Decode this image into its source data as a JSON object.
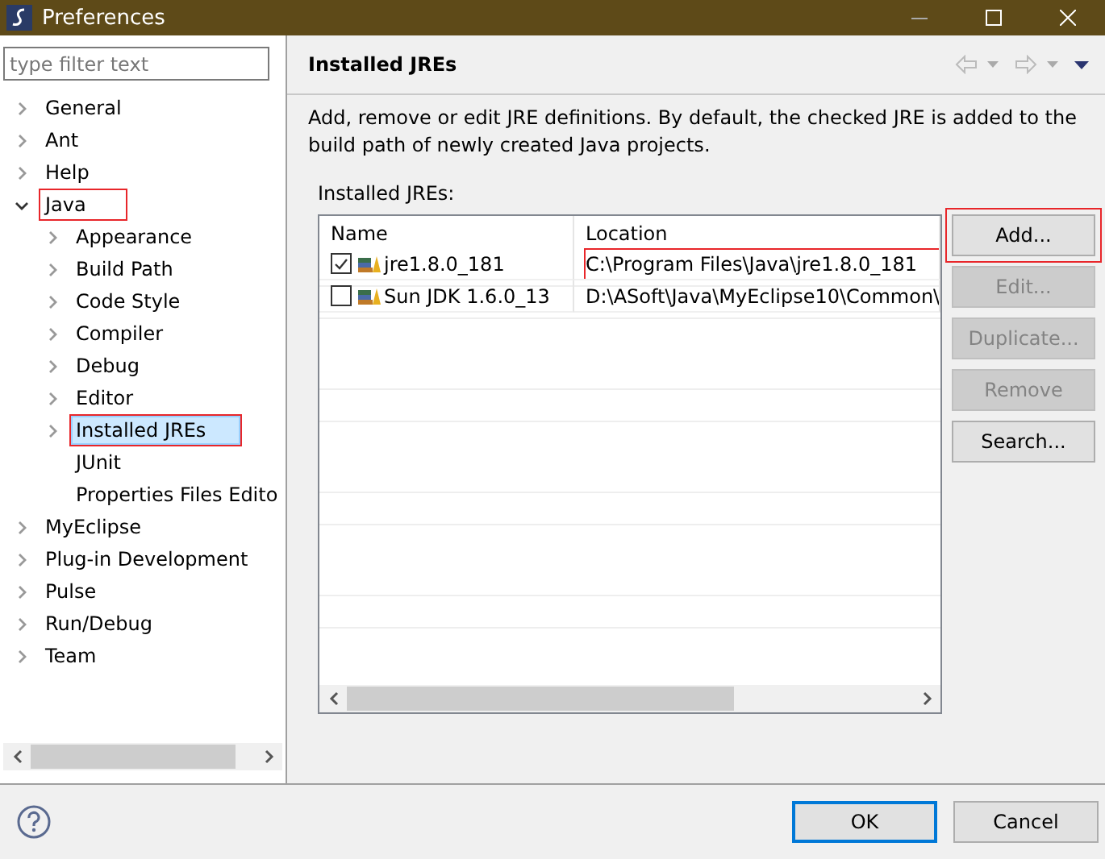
{
  "window": {
    "title": "Preferences"
  },
  "filter": {
    "placeholder": "type filter text"
  },
  "tree": [
    {
      "label": "General",
      "expandable": true,
      "selected": false,
      "highlighted": false
    },
    {
      "label": "Ant",
      "expandable": true,
      "selected": false,
      "highlighted": false
    },
    {
      "label": "Help",
      "expandable": true,
      "selected": false,
      "highlighted": false
    },
    {
      "label": "Java",
      "expandable": true,
      "expanded": true,
      "selected": false,
      "highlighted": true,
      "children": [
        {
          "label": "Appearance",
          "expandable": true,
          "selected": false,
          "highlighted": false
        },
        {
          "label": "Build Path",
          "expandable": true,
          "selected": false,
          "highlighted": false
        },
        {
          "label": "Code Style",
          "expandable": true,
          "selected": false,
          "highlighted": false
        },
        {
          "label": "Compiler",
          "expandable": true,
          "selected": false,
          "highlighted": false
        },
        {
          "label": "Debug",
          "expandable": true,
          "selected": false,
          "highlighted": false
        },
        {
          "label": "Editor",
          "expandable": true,
          "selected": false,
          "highlighted": false
        },
        {
          "label": "Installed JREs",
          "expandable": true,
          "selected": true,
          "highlighted": true
        },
        {
          "label": "JUnit",
          "expandable": false,
          "selected": false,
          "highlighted": false
        },
        {
          "label": "Properties Files Edito",
          "expandable": false,
          "selected": false,
          "highlighted": false
        }
      ]
    },
    {
      "label": "MyEclipse",
      "expandable": true,
      "selected": false,
      "highlighted": false
    },
    {
      "label": "Plug-in Development",
      "expandable": true,
      "selected": false,
      "highlighted": false
    },
    {
      "label": "Pulse",
      "expandable": true,
      "selected": false,
      "highlighted": false
    },
    {
      "label": "Run/Debug",
      "expandable": true,
      "selected": false,
      "highlighted": false
    },
    {
      "label": "Team",
      "expandable": true,
      "selected": false,
      "highlighted": false
    }
  ],
  "page": {
    "title": "Installed JREs",
    "description": "Add, remove or edit JRE definitions. By default, the checked JRE is added to the build path of newly created Java projects.",
    "table_label": "Installed JREs:"
  },
  "table": {
    "columns": [
      "Name",
      "Location"
    ],
    "rows": [
      {
        "name": "jre1.8.0_181",
        "location": "C:\\Program Files\\Java\\jre1.8.0_181",
        "checked": true,
        "highlighted": true
      },
      {
        "name": "Sun JDK 1.6.0_13",
        "location": "D:\\ASoft\\Java\\MyEclipse10\\Common\\",
        "checked": false,
        "highlighted": false
      }
    ]
  },
  "side_buttons": [
    {
      "label": "Add...",
      "disabled": false,
      "highlighted": true
    },
    {
      "label": "Edit...",
      "disabled": true,
      "highlighted": false
    },
    {
      "label": "Duplicate...",
      "disabled": true,
      "highlighted": false
    },
    {
      "label": "Remove",
      "disabled": true,
      "highlighted": false
    },
    {
      "label": "Search...",
      "disabled": false,
      "highlighted": false
    }
  ],
  "buttons": [
    {
      "label": "OK",
      "default": true
    },
    {
      "label": "Cancel",
      "default": false
    }
  ]
}
